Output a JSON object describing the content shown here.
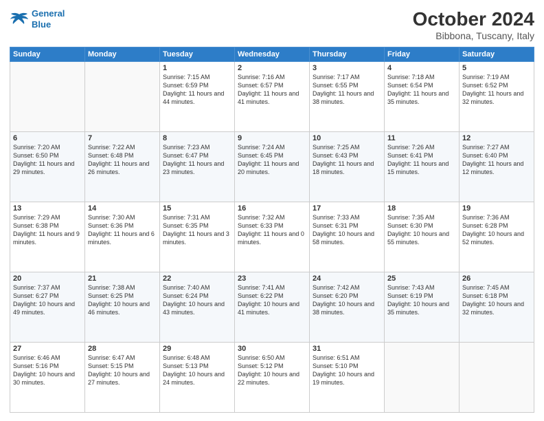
{
  "header": {
    "logo_line1": "General",
    "logo_line2": "Blue",
    "month": "October 2024",
    "location": "Bibbona, Tuscany, Italy"
  },
  "days_of_week": [
    "Sunday",
    "Monday",
    "Tuesday",
    "Wednesday",
    "Thursday",
    "Friday",
    "Saturday"
  ],
  "weeks": [
    [
      {
        "day": "",
        "info": ""
      },
      {
        "day": "",
        "info": ""
      },
      {
        "day": "1",
        "info": "Sunrise: 7:15 AM\nSunset: 6:59 PM\nDaylight: 11 hours\nand 44 minutes."
      },
      {
        "day": "2",
        "info": "Sunrise: 7:16 AM\nSunset: 6:57 PM\nDaylight: 11 hours\nand 41 minutes."
      },
      {
        "day": "3",
        "info": "Sunrise: 7:17 AM\nSunset: 6:55 PM\nDaylight: 11 hours\nand 38 minutes."
      },
      {
        "day": "4",
        "info": "Sunrise: 7:18 AM\nSunset: 6:54 PM\nDaylight: 11 hours\nand 35 minutes."
      },
      {
        "day": "5",
        "info": "Sunrise: 7:19 AM\nSunset: 6:52 PM\nDaylight: 11 hours\nand 32 minutes."
      }
    ],
    [
      {
        "day": "6",
        "info": "Sunrise: 7:20 AM\nSunset: 6:50 PM\nDaylight: 11 hours\nand 29 minutes."
      },
      {
        "day": "7",
        "info": "Sunrise: 7:22 AM\nSunset: 6:48 PM\nDaylight: 11 hours\nand 26 minutes."
      },
      {
        "day": "8",
        "info": "Sunrise: 7:23 AM\nSunset: 6:47 PM\nDaylight: 11 hours\nand 23 minutes."
      },
      {
        "day": "9",
        "info": "Sunrise: 7:24 AM\nSunset: 6:45 PM\nDaylight: 11 hours\nand 20 minutes."
      },
      {
        "day": "10",
        "info": "Sunrise: 7:25 AM\nSunset: 6:43 PM\nDaylight: 11 hours\nand 18 minutes."
      },
      {
        "day": "11",
        "info": "Sunrise: 7:26 AM\nSunset: 6:41 PM\nDaylight: 11 hours\nand 15 minutes."
      },
      {
        "day": "12",
        "info": "Sunrise: 7:27 AM\nSunset: 6:40 PM\nDaylight: 11 hours\nand 12 minutes."
      }
    ],
    [
      {
        "day": "13",
        "info": "Sunrise: 7:29 AM\nSunset: 6:38 PM\nDaylight: 11 hours\nand 9 minutes."
      },
      {
        "day": "14",
        "info": "Sunrise: 7:30 AM\nSunset: 6:36 PM\nDaylight: 11 hours\nand 6 minutes."
      },
      {
        "day": "15",
        "info": "Sunrise: 7:31 AM\nSunset: 6:35 PM\nDaylight: 11 hours\nand 3 minutes."
      },
      {
        "day": "16",
        "info": "Sunrise: 7:32 AM\nSunset: 6:33 PM\nDaylight: 11 hours\nand 0 minutes."
      },
      {
        "day": "17",
        "info": "Sunrise: 7:33 AM\nSunset: 6:31 PM\nDaylight: 10 hours\nand 58 minutes."
      },
      {
        "day": "18",
        "info": "Sunrise: 7:35 AM\nSunset: 6:30 PM\nDaylight: 10 hours\nand 55 minutes."
      },
      {
        "day": "19",
        "info": "Sunrise: 7:36 AM\nSunset: 6:28 PM\nDaylight: 10 hours\nand 52 minutes."
      }
    ],
    [
      {
        "day": "20",
        "info": "Sunrise: 7:37 AM\nSunset: 6:27 PM\nDaylight: 10 hours\nand 49 minutes."
      },
      {
        "day": "21",
        "info": "Sunrise: 7:38 AM\nSunset: 6:25 PM\nDaylight: 10 hours\nand 46 minutes."
      },
      {
        "day": "22",
        "info": "Sunrise: 7:40 AM\nSunset: 6:24 PM\nDaylight: 10 hours\nand 43 minutes."
      },
      {
        "day": "23",
        "info": "Sunrise: 7:41 AM\nSunset: 6:22 PM\nDaylight: 10 hours\nand 41 minutes."
      },
      {
        "day": "24",
        "info": "Sunrise: 7:42 AM\nSunset: 6:20 PM\nDaylight: 10 hours\nand 38 minutes."
      },
      {
        "day": "25",
        "info": "Sunrise: 7:43 AM\nSunset: 6:19 PM\nDaylight: 10 hours\nand 35 minutes."
      },
      {
        "day": "26",
        "info": "Sunrise: 7:45 AM\nSunset: 6:18 PM\nDaylight: 10 hours\nand 32 minutes."
      }
    ],
    [
      {
        "day": "27",
        "info": "Sunrise: 6:46 AM\nSunset: 5:16 PM\nDaylight: 10 hours\nand 30 minutes."
      },
      {
        "day": "28",
        "info": "Sunrise: 6:47 AM\nSunset: 5:15 PM\nDaylight: 10 hours\nand 27 minutes."
      },
      {
        "day": "29",
        "info": "Sunrise: 6:48 AM\nSunset: 5:13 PM\nDaylight: 10 hours\nand 24 minutes."
      },
      {
        "day": "30",
        "info": "Sunrise: 6:50 AM\nSunset: 5:12 PM\nDaylight: 10 hours\nand 22 minutes."
      },
      {
        "day": "31",
        "info": "Sunrise: 6:51 AM\nSunset: 5:10 PM\nDaylight: 10 hours\nand 19 minutes."
      },
      {
        "day": "",
        "info": ""
      },
      {
        "day": "",
        "info": ""
      }
    ]
  ]
}
